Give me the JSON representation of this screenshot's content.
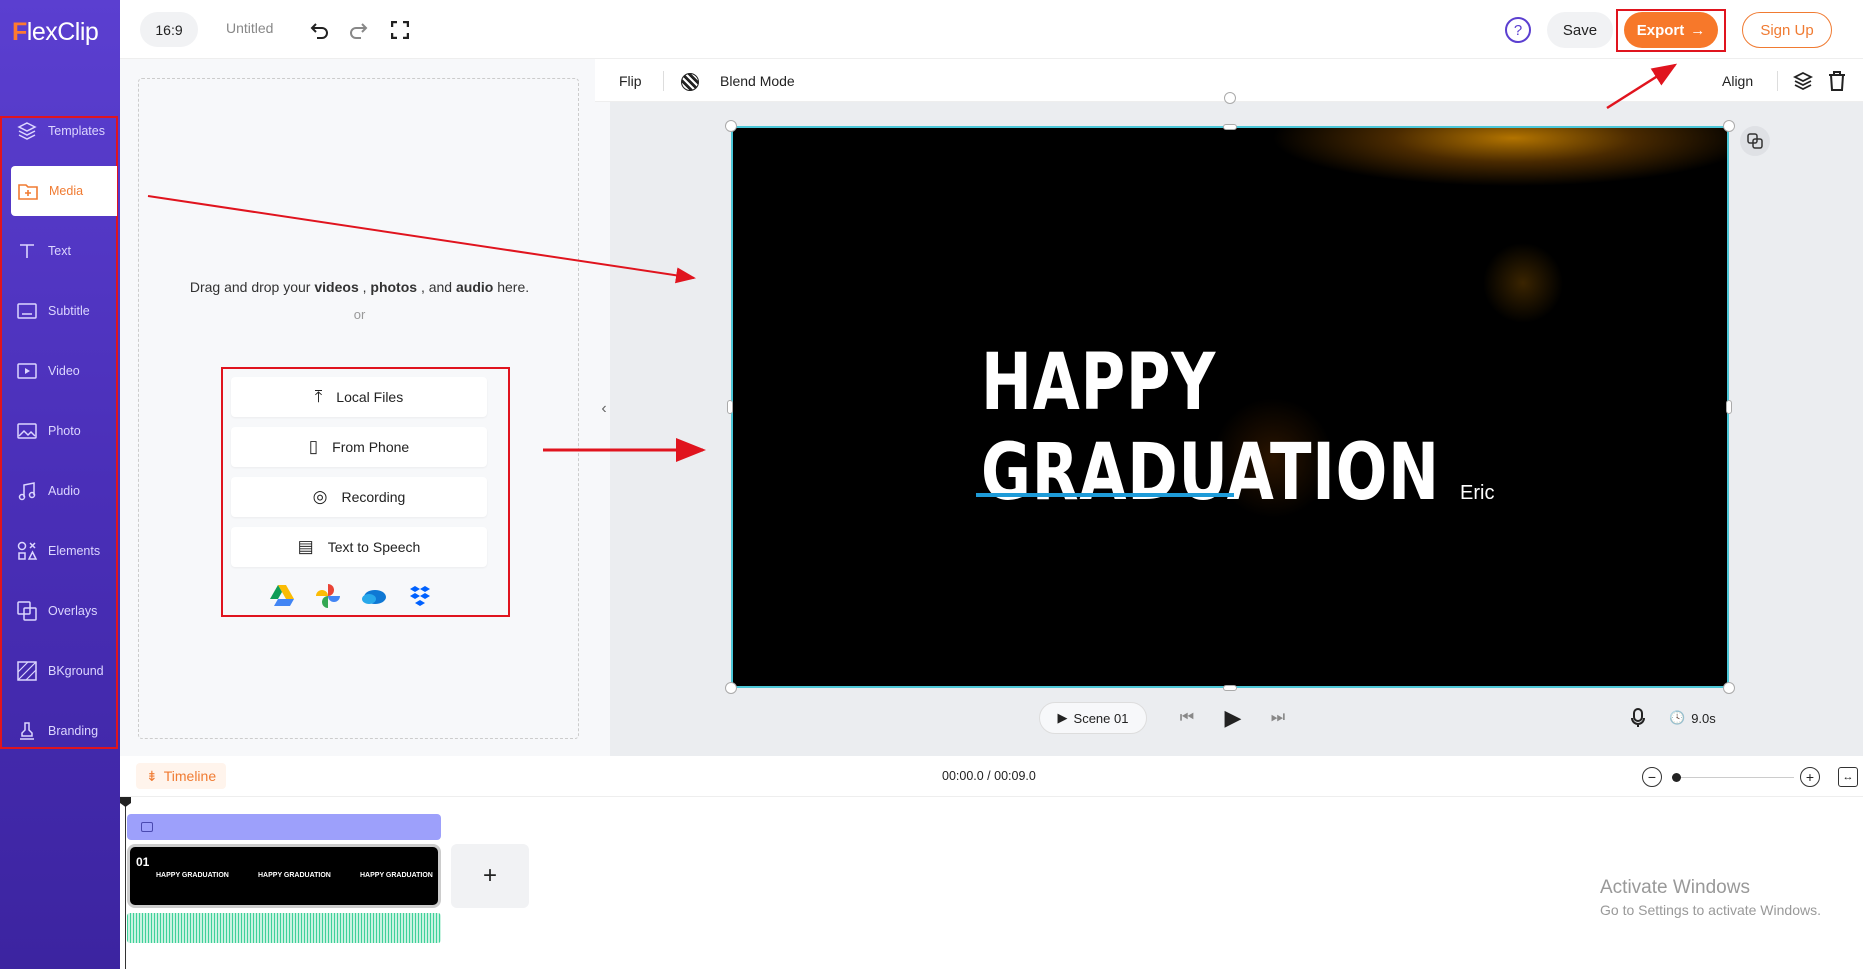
{
  "app": {
    "brand_first": "F",
    "brand_rest": "lexClip"
  },
  "topbar": {
    "aspect": "16:9",
    "title": "Untitled",
    "save": "Save",
    "export": "Export",
    "signup": "Sign Up"
  },
  "sidebar": {
    "items": [
      {
        "label": "Templates",
        "icon": "layers"
      },
      {
        "label": "Media",
        "icon": "folder-plus"
      },
      {
        "label": "Text",
        "icon": "text"
      },
      {
        "label": "Subtitle",
        "icon": "subtitle"
      },
      {
        "label": "Video",
        "icon": "video"
      },
      {
        "label": "Photo",
        "icon": "photo"
      },
      {
        "label": "Audio",
        "icon": "music"
      },
      {
        "label": "Elements",
        "icon": "shapes"
      },
      {
        "label": "Overlays",
        "icon": "overlays"
      },
      {
        "label": "BKground",
        "icon": "background"
      },
      {
        "label": "Branding",
        "icon": "stamp"
      }
    ]
  },
  "panel": {
    "drop_pre": "Drag and drop your ",
    "videos": "videos",
    "photos": "photos",
    "audio": "audio",
    "sep1": " , ",
    "sep2": " , and ",
    "drop_post": " here.",
    "or": "or",
    "sources": [
      "Local Files",
      "From Phone",
      "Recording",
      "Text to Speech"
    ],
    "cloud": [
      "google-drive",
      "google-photos",
      "onedrive",
      "dropbox"
    ]
  },
  "toolbar": {
    "flip": "Flip",
    "blend": "Blend Mode",
    "align": "Align"
  },
  "canvas": {
    "headline": "HAPPY GRADUATION",
    "name": "Eric"
  },
  "player": {
    "scene": "Scene 01",
    "duration": "9.0s"
  },
  "timeline": {
    "label": "Timeline",
    "time": "00:00.0 / 00:09.0",
    "scene_num": "01",
    "thumb_text": "HAPPY GRADUATION",
    "add": "+"
  },
  "watermark": {
    "line1": "Activate Windows",
    "line2": "Go to Settings to activate Windows."
  },
  "colors": {
    "accent": "#f07b32",
    "sidebar": "#5b3fd0",
    "selection": "#4cc7d8",
    "annotation": "#e0141e"
  }
}
